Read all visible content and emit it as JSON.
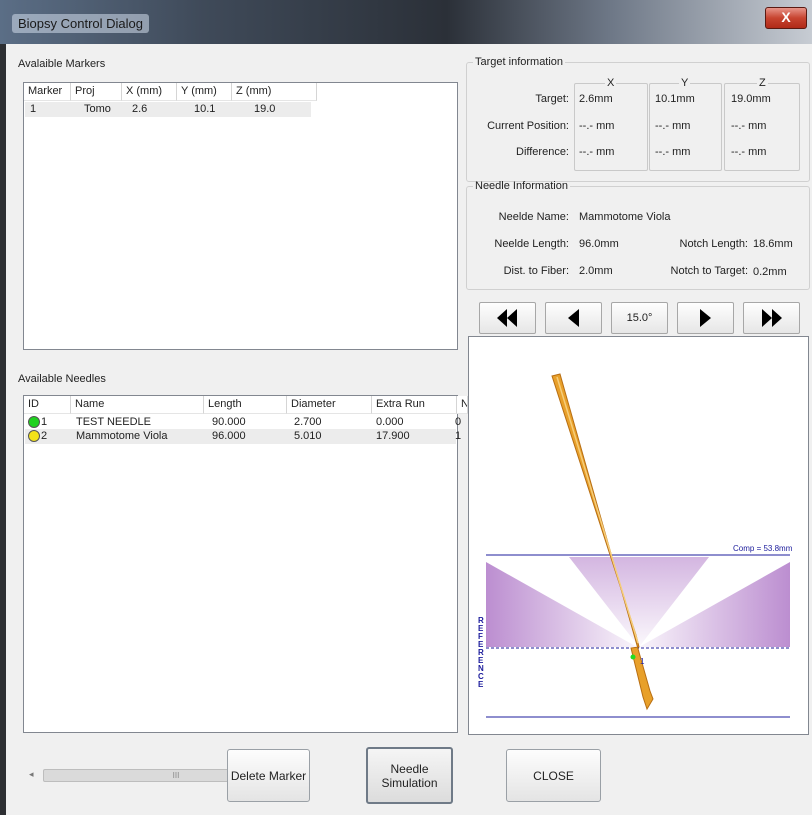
{
  "window": {
    "title": "Biopsy Control Dialog",
    "close_glyph": "X"
  },
  "markers": {
    "section_label": "Avalaible Markers",
    "columns": [
      "Marker",
      "Proj",
      "X (mm)",
      "Y (mm)",
      "Z (mm)"
    ],
    "rows": [
      [
        "1",
        "Tomo",
        "2.6",
        "10.1",
        "19.0"
      ]
    ]
  },
  "needles": {
    "section_label": "Available Needles",
    "columns": [
      "ID",
      "Name",
      "Length",
      "Diameter",
      "Extra Run",
      "N"
    ],
    "rows": [
      {
        "id": "1",
        "status": "#1fd11f",
        "name": "TEST NEEDLE",
        "length": "90.000",
        "diameter": "2.700",
        "extra_run": "0.000",
        "n": "0"
      },
      {
        "id": "2",
        "status": "#f3e21a",
        "name": "Mammotome Viola",
        "length": "96.000",
        "diameter": "5.010",
        "extra_run": "17.900",
        "n": "1"
      }
    ],
    "scroll_thumb": "III"
  },
  "target": {
    "legend": "Target information",
    "col_x": "X",
    "col_y": "Y",
    "col_z": "Z",
    "target_label": "Target:",
    "target_x": "2.6mm",
    "target_y": "10.1mm",
    "target_z": "19.0mm",
    "current_label": "Current Position:",
    "current_x": "--.- mm",
    "current_y": "--.- mm",
    "current_z": "--.- mm",
    "diff_label": "Difference:",
    "diff_x": "--.- mm",
    "diff_y": "--.- mm",
    "diff_z": "--.- mm"
  },
  "needle_info": {
    "legend": "Needle Information",
    "name_label": "Neelde Name:",
    "name_value": "Mammotome Viola",
    "length_label": "Neelde Length:",
    "length_value": "96.0mm",
    "notch_label": "Notch Length:",
    "notch_value": "18.6mm",
    "fiber_label": "Dist. to Fiber:",
    "fiber_value": "2.0mm",
    "ntt_label": "Notch to Target:",
    "ntt_value": "0.2mm"
  },
  "nav": {
    "angle": "15.0°",
    "icons": [
      "fast-backward-icon",
      "step-backward-icon",
      "step-forward-icon",
      "fast-forward-icon"
    ]
  },
  "simulation": {
    "comp_label": "Comp = 53.8mm",
    "reference_label": "REFERENCE",
    "marker_label": "1",
    "needle_color": "#e8a02a",
    "cone_color": "#b07ac8"
  },
  "buttons": {
    "delete": "Delete Marker",
    "sim_line1": "Needle",
    "sim_line2": "Simulation",
    "close": "CLOSE"
  }
}
